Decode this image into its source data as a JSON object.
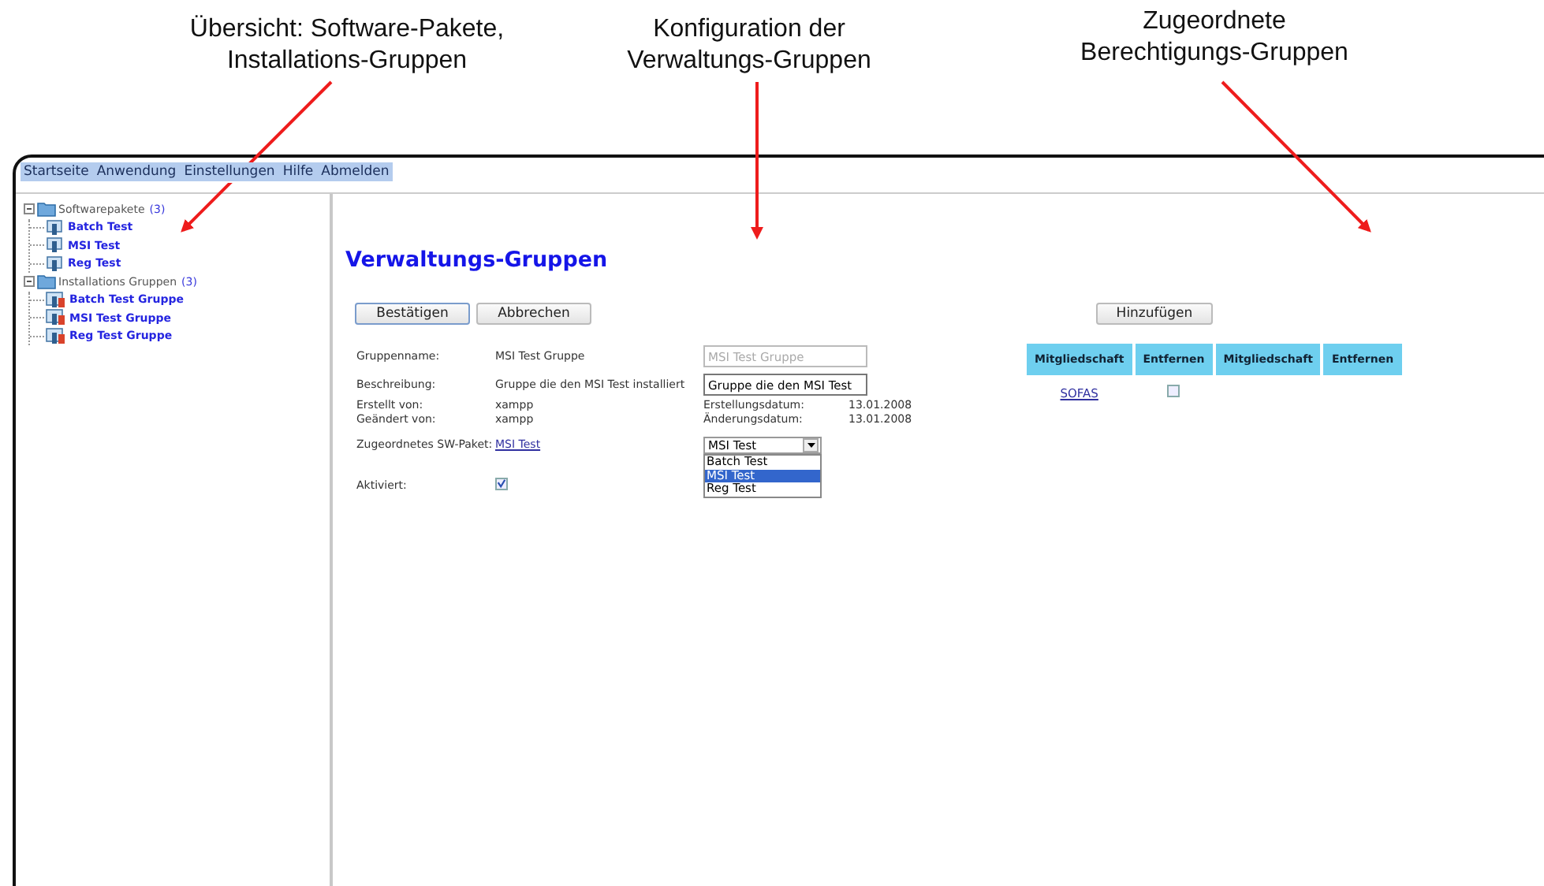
{
  "callouts": [
    {
      "lines": [
        "Übersicht: Software-Pakete,",
        "Installations-Gruppen"
      ]
    },
    {
      "lines": [
        "Konfiguration der",
        "Verwaltungs-Gruppen"
      ]
    },
    {
      "lines": [
        "Zugeordnete",
        "Berechtigungs-Gruppen"
      ]
    }
  ],
  "menu": [
    "Startseite",
    "Anwendung",
    "Einstellungen",
    "Hilfe",
    "Abmelden"
  ],
  "tree": [
    {
      "label": "Softwarepakete",
      "count": "(3)",
      "expanded": true,
      "children": [
        {
          "label": "Batch Test",
          "kind": "package"
        },
        {
          "label": "MSI Test",
          "kind": "package"
        },
        {
          "label": "Reg Test",
          "kind": "package"
        }
      ]
    },
    {
      "label": "Installations Gruppen",
      "count": "(3)",
      "expanded": true,
      "children": [
        {
          "label": "Batch Test Gruppe",
          "kind": "group"
        },
        {
          "label": "MSI Test Gruppe",
          "kind": "group"
        },
        {
          "label": "Reg Test Gruppe",
          "kind": "group"
        }
      ]
    }
  ],
  "title": "Verwaltungs-Gruppen",
  "buttons": [
    "Bestätigen",
    "Abbrechen"
  ],
  "add_button": "Hinzufügen",
  "form": {
    "name_label": "Gruppenname:",
    "name_value": "MSI Test Gruppe",
    "name_placeholder": "MSI Test Gruppe",
    "desc_label": "Beschreibung:",
    "desc_value": "Gruppe die den MSI Test installiert",
    "desc_input": "Gruppe die den MSI Test",
    "created_label": "Erstellt von:",
    "created_value": "xampp",
    "created_date_label": "Erstellungsdatum:",
    "created_date": "13.01.2008",
    "changed_label": "Geändert von:",
    "changed_value": "xampp",
    "changed_date_label": "Änderungsdatum:",
    "changed_date": "13.01.2008",
    "package_label": "Zugeordnetes SW-Paket:",
    "package_link": "MSI Test",
    "select": {
      "value": "MSI Test",
      "expanded": true,
      "options": [
        {
          "label": "Batch Test",
          "selected": false
        },
        {
          "label": "MSI Test",
          "selected": true
        },
        {
          "label": "Reg Test",
          "selected": false
        }
      ]
    },
    "active_label": "Aktiviert:",
    "active": true
  },
  "table": {
    "columns": [
      "Mitgliedschaft",
      "Entfernen",
      "Mitgliedschaft",
      "Entfernen"
    ],
    "rows": [
      {
        "name": "SOFAS",
        "remove": false
      }
    ]
  }
}
